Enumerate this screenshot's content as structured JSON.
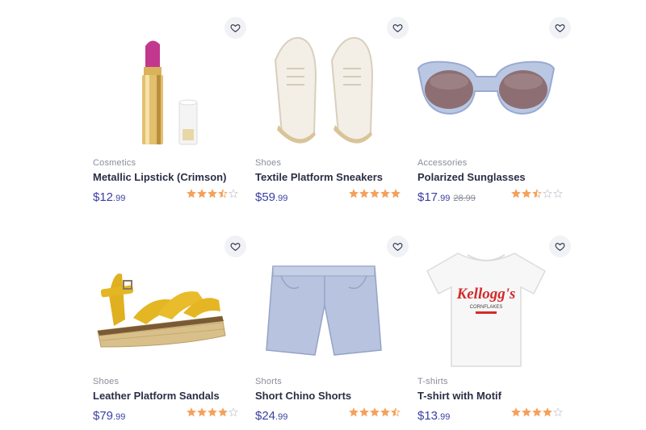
{
  "products": [
    {
      "category": "Cosmetics",
      "name": "Metallic Lipstick (Crimson)",
      "price_main": "$12",
      "price_cents": ".99",
      "old_price": "",
      "rating": 3.5,
      "image": "lipstick-image",
      "wishlist_icon": "heart-icon"
    },
    {
      "category": "Shoes",
      "name": "Textile Platform Sneakers",
      "price_main": "$59",
      "price_cents": ".99",
      "old_price": "",
      "rating": 5,
      "image": "sneakers-image",
      "wishlist_icon": "heart-icon"
    },
    {
      "category": "Accessories",
      "name": "Polarized Sunglasses",
      "price_main": "$17",
      "price_cents": ".99",
      "old_price": "28.99",
      "rating": 2.5,
      "image": "sunglasses-image",
      "wishlist_icon": "heart-icon"
    },
    {
      "category": "Shoes",
      "name": "Leather Platform Sandals",
      "price_main": "$79",
      "price_cents": ".99",
      "old_price": "",
      "rating": 4,
      "image": "sandals-image",
      "wishlist_icon": "heart-icon"
    },
    {
      "category": "Shorts",
      "name": "Short Chino Shorts",
      "price_main": "$24",
      "price_cents": ".99",
      "old_price": "",
      "rating": 4.5,
      "image": "shorts-image",
      "wishlist_icon": "heart-icon"
    },
    {
      "category": "T-shirts",
      "name": "T-shirt with Motif",
      "price_main": "$13",
      "price_cents": ".99",
      "old_price": "",
      "rating": 4,
      "image": "tshirt-image",
      "wishlist_icon": "heart-icon"
    }
  ],
  "tshirt_print": {
    "brand": "Kellogg's",
    "line1": "CORNFLAKES"
  },
  "colors": {
    "price": "#3b3fa5",
    "star": "#f4a15c",
    "star_empty": "#c9cbd3",
    "wishlist_bg": "#f1f2f6"
  }
}
